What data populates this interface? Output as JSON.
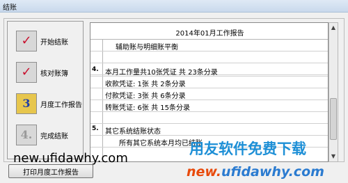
{
  "window": {
    "title": "结账"
  },
  "nav": [
    {
      "label": "开始结账",
      "icon": "checkmark-icon",
      "glyph": "✓"
    },
    {
      "label": "核对账簿",
      "icon": "checkmark-icon",
      "glyph": "✓"
    },
    {
      "label": "月度工作报告",
      "icon": "step-3-icon",
      "glyph": "3"
    },
    {
      "label": "完成结账",
      "icon": "step-4-icon",
      "glyph": "4."
    }
  ],
  "report": {
    "title": "2014年01月工作报告",
    "rows": [
      {
        "num": "",
        "text": "辅助账与明细账平衡"
      },
      {
        "num": "",
        "text": ""
      },
      {
        "num": "",
        "text": ""
      },
      {
        "num": "4.",
        "text": "本月工作量共10张凭证 共 23条分录"
      },
      {
        "num": "",
        "text": "收款凭证: 1张  共  2条分录"
      },
      {
        "num": "",
        "text": "付款凭证: 3张  共  6条分录"
      },
      {
        "num": "",
        "text": "转账凭证: 6张  共  15条分录"
      },
      {
        "num": "",
        "text": ""
      },
      {
        "num": "5.",
        "text": "其它系统结账状态"
      },
      {
        "num": "",
        "text": "所有其它系统本月均已结账"
      }
    ]
  },
  "buttons": {
    "print": "打印月度工作报告"
  },
  "watermark": {
    "url": "new.ufidawhy.com",
    "cn": "用友软件免费下载",
    "logo_a": "new.",
    "logo_b": "ufidawhy.com"
  }
}
